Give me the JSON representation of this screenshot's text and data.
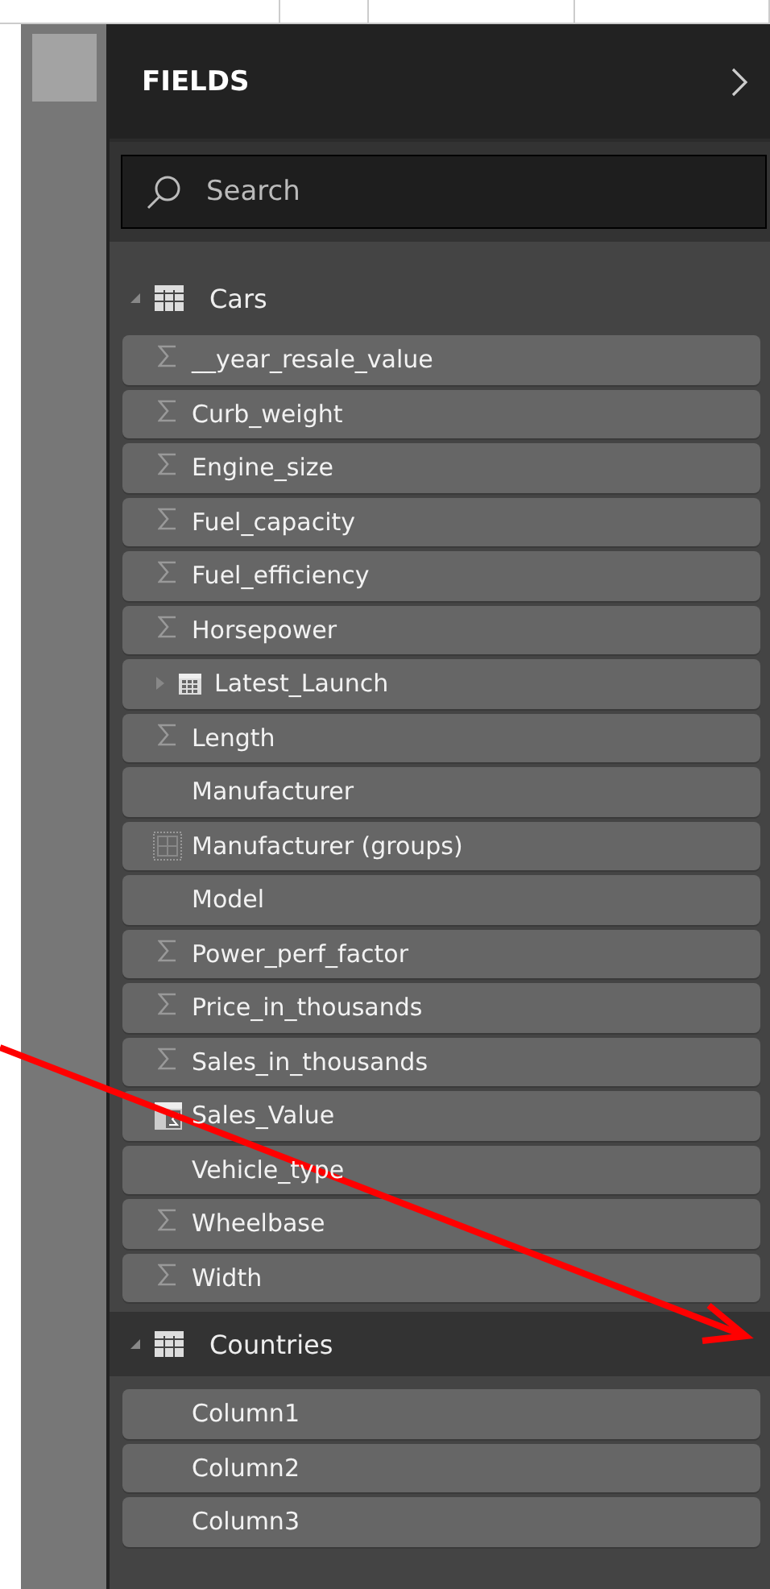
{
  "panel": {
    "title": "FIELDS"
  },
  "search": {
    "placeholder": "Search"
  },
  "tables": [
    {
      "name": "Cars",
      "expanded": true,
      "fields": [
        {
          "name": "__year_resale_value",
          "kind": "sum"
        },
        {
          "name": "Curb_weight",
          "kind": "sum"
        },
        {
          "name": "Engine_size",
          "kind": "sum"
        },
        {
          "name": "Fuel_capacity",
          "kind": "sum"
        },
        {
          "name": "Fuel_efficiency",
          "kind": "sum"
        },
        {
          "name": "Horsepower",
          "kind": "sum"
        },
        {
          "name": "Latest_Launch",
          "kind": "date"
        },
        {
          "name": "Length",
          "kind": "sum"
        },
        {
          "name": "Manufacturer",
          "kind": "text"
        },
        {
          "name": "Manufacturer (groups)",
          "kind": "group"
        },
        {
          "name": "Model",
          "kind": "text"
        },
        {
          "name": "Power_perf_factor",
          "kind": "sum"
        },
        {
          "name": "Price_in_thousands",
          "kind": "sum"
        },
        {
          "name": "Sales_in_thousands",
          "kind": "sum"
        },
        {
          "name": "Sales_Value",
          "kind": "measure"
        },
        {
          "name": "Vehicle_type",
          "kind": "text"
        },
        {
          "name": "Wheelbase",
          "kind": "sum"
        },
        {
          "name": "Width",
          "kind": "sum"
        }
      ]
    },
    {
      "name": "Countries",
      "expanded": true,
      "fields": [
        {
          "name": "Column1",
          "kind": "text"
        },
        {
          "name": "Column2",
          "kind": "text"
        },
        {
          "name": "Column3",
          "kind": "text"
        }
      ]
    }
  ]
}
